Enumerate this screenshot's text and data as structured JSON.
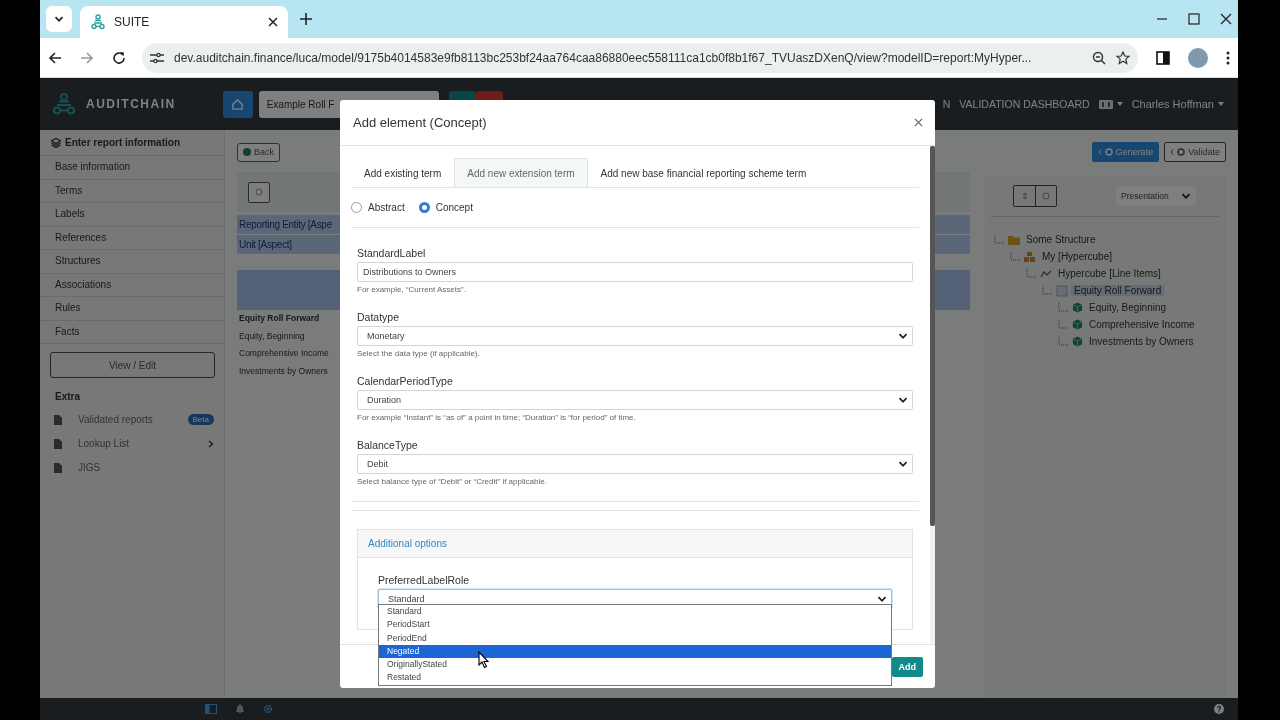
{
  "browser": {
    "tab_title": "SUITE",
    "address": "dev.auditchain.finance/luca/model/9175b4014583e9fb8113bc253bf24aa764caa86880eec558111ca1cb0f8b1f67_TVUaszDXenQ/view?modelID=report:MyHyper..."
  },
  "app_nav": {
    "brand": "AUDITCHAIN",
    "search_value": "Example Roll F",
    "links": [
      "N",
      "VALIDATION DASHBOARD"
    ],
    "user": "Charles Hoffman"
  },
  "sidebar": {
    "heading": "Enter report information",
    "items": [
      "Base information",
      "Terms",
      "Labels",
      "References",
      "Structures",
      "Associations",
      "Rules",
      "Facts"
    ],
    "view_edit_button": "View / Edit",
    "extra_heading": "Extra",
    "extra_items": [
      {
        "label": "Validated reports",
        "badge": "Beta",
        "submenu": false
      },
      {
        "label": "Lookup List",
        "submenu": true
      },
      {
        "label": "JIGS",
        "submenu": false
      }
    ]
  },
  "workspace": {
    "back_button": "Back",
    "generate_button": "Generate",
    "validate_button": "Validate",
    "aspects": [
      "Reporting Entity [Aspe",
      "Unit [Aspect]"
    ],
    "line_items": [
      {
        "label": "Equity Roll Forward",
        "kind": "abstract"
      },
      {
        "label": "Equity, Beginning",
        "kind": "concept"
      },
      {
        "label": "Comprehensive Income",
        "kind": "concept"
      },
      {
        "label": "Investments by Owners",
        "kind": "concept"
      }
    ],
    "view_select": "Presentation",
    "tree": [
      {
        "label": "Some Structure",
        "kind": "structure",
        "selected": false,
        "children": [
          {
            "label": "My [Hypercube]",
            "kind": "hypercube",
            "selected": false,
            "children": [
              {
                "label": "Hypercube [Line Items]",
                "kind": "lineitems",
                "selected": false,
                "children": [
                  {
                    "label": "Equity Roll Forward",
                    "kind": "abstract",
                    "selected": true,
                    "children": [
                      {
                        "label": "Equity, Beginning",
                        "kind": "concept",
                        "selected": false
                      },
                      {
                        "label": "Comprehensive Income",
                        "kind": "concept",
                        "selected": false
                      },
                      {
                        "label": "Investments by Owners",
                        "kind": "concept",
                        "selected": false
                      }
                    ]
                  }
                ]
              }
            ]
          }
        ]
      }
    ]
  },
  "modal": {
    "title": "Add element (Concept)",
    "tabs": [
      {
        "label": "Add existing term",
        "selected": false
      },
      {
        "label": "Add new extension term",
        "selected": true
      },
      {
        "label": "Add new base financial reporting scheme term",
        "selected": false
      }
    ],
    "element_types": [
      {
        "label": "Abstract",
        "selected": false
      },
      {
        "label": "Concept",
        "selected": true
      }
    ],
    "fields": [
      {
        "label": "StandardLabel",
        "kind": "text",
        "value": "Distributions to Owners",
        "help": "For example, “Current Assets”."
      },
      {
        "label": "Datatype",
        "kind": "select",
        "value": "Monetary",
        "help": "Select the data type (if applicable)."
      },
      {
        "label": "CalendarPeriodType",
        "kind": "select",
        "value": "Duration",
        "help": "For example “Instant” is “as of” a point in time; “Duration” is “for period” of time."
      },
      {
        "label": "BalanceType",
        "kind": "select",
        "value": "Debit",
        "help": "Select balance type of “Debit” or “Credit” if applicable."
      }
    ],
    "additional_options": {
      "title": "Additional options",
      "label": "PreferredLabelRole",
      "value": "Standard",
      "options": [
        {
          "label": "Standard",
          "highlighted": false
        },
        {
          "label": "PeriodStart",
          "highlighted": false
        },
        {
          "label": "PeriodEnd",
          "highlighted": false
        },
        {
          "label": "Negated",
          "highlighted": true
        },
        {
          "label": "OriginallyStated",
          "highlighted": false
        },
        {
          "label": "Restated",
          "highlighted": false
        }
      ]
    },
    "add_button": "Add"
  }
}
